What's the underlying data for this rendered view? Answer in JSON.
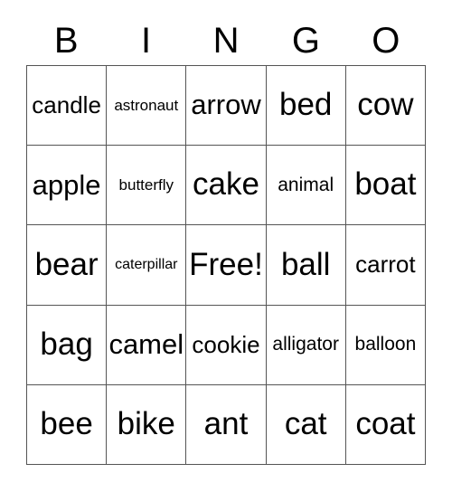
{
  "card": {
    "header": {
      "letters": [
        "B",
        "I",
        "N",
        "G",
        "O"
      ]
    },
    "grid": {
      "columns": 5,
      "rows": 5,
      "free_space_label": "Free!",
      "free_space_position": "row 3, column 3",
      "border_color": "#555555",
      "background_color": "#ffffff",
      "text_color": "#000000",
      "cells": [
        [
          {
            "label": "candle",
            "size": "md"
          },
          {
            "label": "astronaut",
            "size": "xs"
          },
          {
            "label": "arrow",
            "size": "lg"
          },
          {
            "label": "bed",
            "size": "xl"
          },
          {
            "label": "cow",
            "size": "xl"
          }
        ],
        [
          {
            "label": "apple",
            "size": "lg"
          },
          {
            "label": "butterfly",
            "size": "xs"
          },
          {
            "label": "cake",
            "size": "xl"
          },
          {
            "label": "animal",
            "size": "sm"
          },
          {
            "label": "boat",
            "size": "xl"
          }
        ],
        [
          {
            "label": "bear",
            "size": "xl"
          },
          {
            "label": "caterpillar",
            "size": "xxs"
          },
          {
            "label": "Free!",
            "size": "xl"
          },
          {
            "label": "ball",
            "size": "xl"
          },
          {
            "label": "carrot",
            "size": "md"
          }
        ],
        [
          {
            "label": "bag",
            "size": "xl"
          },
          {
            "label": "camel",
            "size": "lg"
          },
          {
            "label": "cookie",
            "size": "md"
          },
          {
            "label": "alligator",
            "size": "sm"
          },
          {
            "label": "balloon",
            "size": "sm"
          }
        ],
        [
          {
            "label": "bee",
            "size": "xl"
          },
          {
            "label": "bike",
            "size": "xl"
          },
          {
            "label": "ant",
            "size": "xl"
          },
          {
            "label": "cat",
            "size": "xl"
          },
          {
            "label": "coat",
            "size": "xl"
          }
        ]
      ]
    }
  }
}
